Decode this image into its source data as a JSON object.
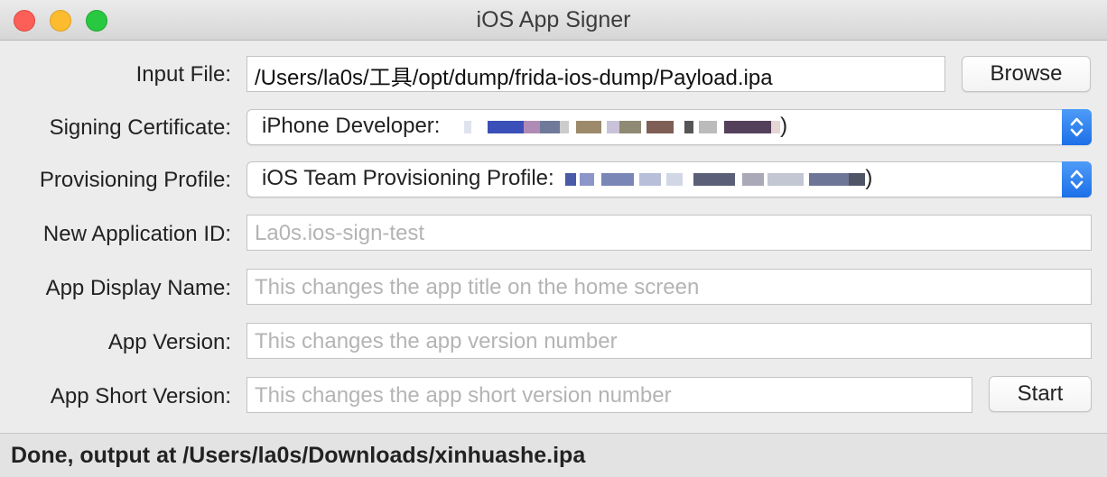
{
  "window": {
    "title": "iOS App Signer",
    "controls": [
      "close-icon",
      "minimize-icon",
      "zoom-icon"
    ],
    "colors": {
      "close": "#fc5f57",
      "minimize": "#fdbc2e",
      "zoom": "#28c840",
      "accent": "#1c6fe8"
    }
  },
  "form": {
    "input_file": {
      "label": "Input File:",
      "value": "/Users/la0s/工具/opt/dump/frida-ios-dump/Payload.ipa",
      "browse_label": "Browse"
    },
    "signing_certificate": {
      "label": "Signing Certificate:",
      "selected_prefix": "iPhone Developer: ",
      "selected_suffix": ")"
    },
    "provisioning_profile": {
      "label": "Provisioning Profile:",
      "selected_prefix": "iOS Team Provisioning Profile: ",
      "selected_suffix": ")"
    },
    "new_application_id": {
      "label": "New Application ID:",
      "value": "",
      "placeholder": "La0s.ios-sign-test"
    },
    "app_display_name": {
      "label": "App Display Name:",
      "value": "",
      "placeholder": "This changes the app title on the home screen"
    },
    "app_version": {
      "label": "App Version:",
      "value": "",
      "placeholder": "This changes the app version number"
    },
    "app_short_version": {
      "label": "App Short Version:",
      "value": "",
      "placeholder": "This changes the app short version number",
      "start_label": "Start"
    }
  },
  "status": {
    "text": "Done, output at /Users/la0s/Downloads/xinhuashe.ipa"
  }
}
